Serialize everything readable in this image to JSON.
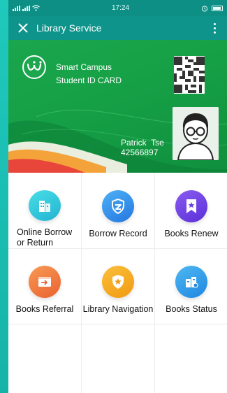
{
  "status_bar": {
    "time": "17:24"
  },
  "app_bar": {
    "title": "Library Service"
  },
  "card": {
    "line1": "Smart Campus",
    "line2": "Student ID CARD",
    "name": "Patrick  Tse",
    "id": "42566897"
  },
  "menu": [
    {
      "label_line1": "Online Borrow",
      "label_line2": "or Return",
      "icon": "building-icon",
      "color": "#2ec6d6"
    },
    {
      "label_line1": "Borrow Record",
      "label_line2": "",
      "icon": "shield-icon",
      "color": "#2f8fe8"
    },
    {
      "label_line1": "Books Renew",
      "label_line2": "",
      "icon": "bookmark-icon",
      "color": "#6d3fe0"
    },
    {
      "label_line1": "Books Referral",
      "label_line2": "",
      "icon": "referral-icon",
      "color": "#f07a3a"
    },
    {
      "label_line1": "Library Navigation",
      "label_line2": "",
      "icon": "navigation-shield-icon",
      "color": "#f4a51a"
    },
    {
      "label_line1": "Books Status",
      "label_line2": "",
      "icon": "books-status-icon",
      "color": "#2d9ae6"
    }
  ]
}
